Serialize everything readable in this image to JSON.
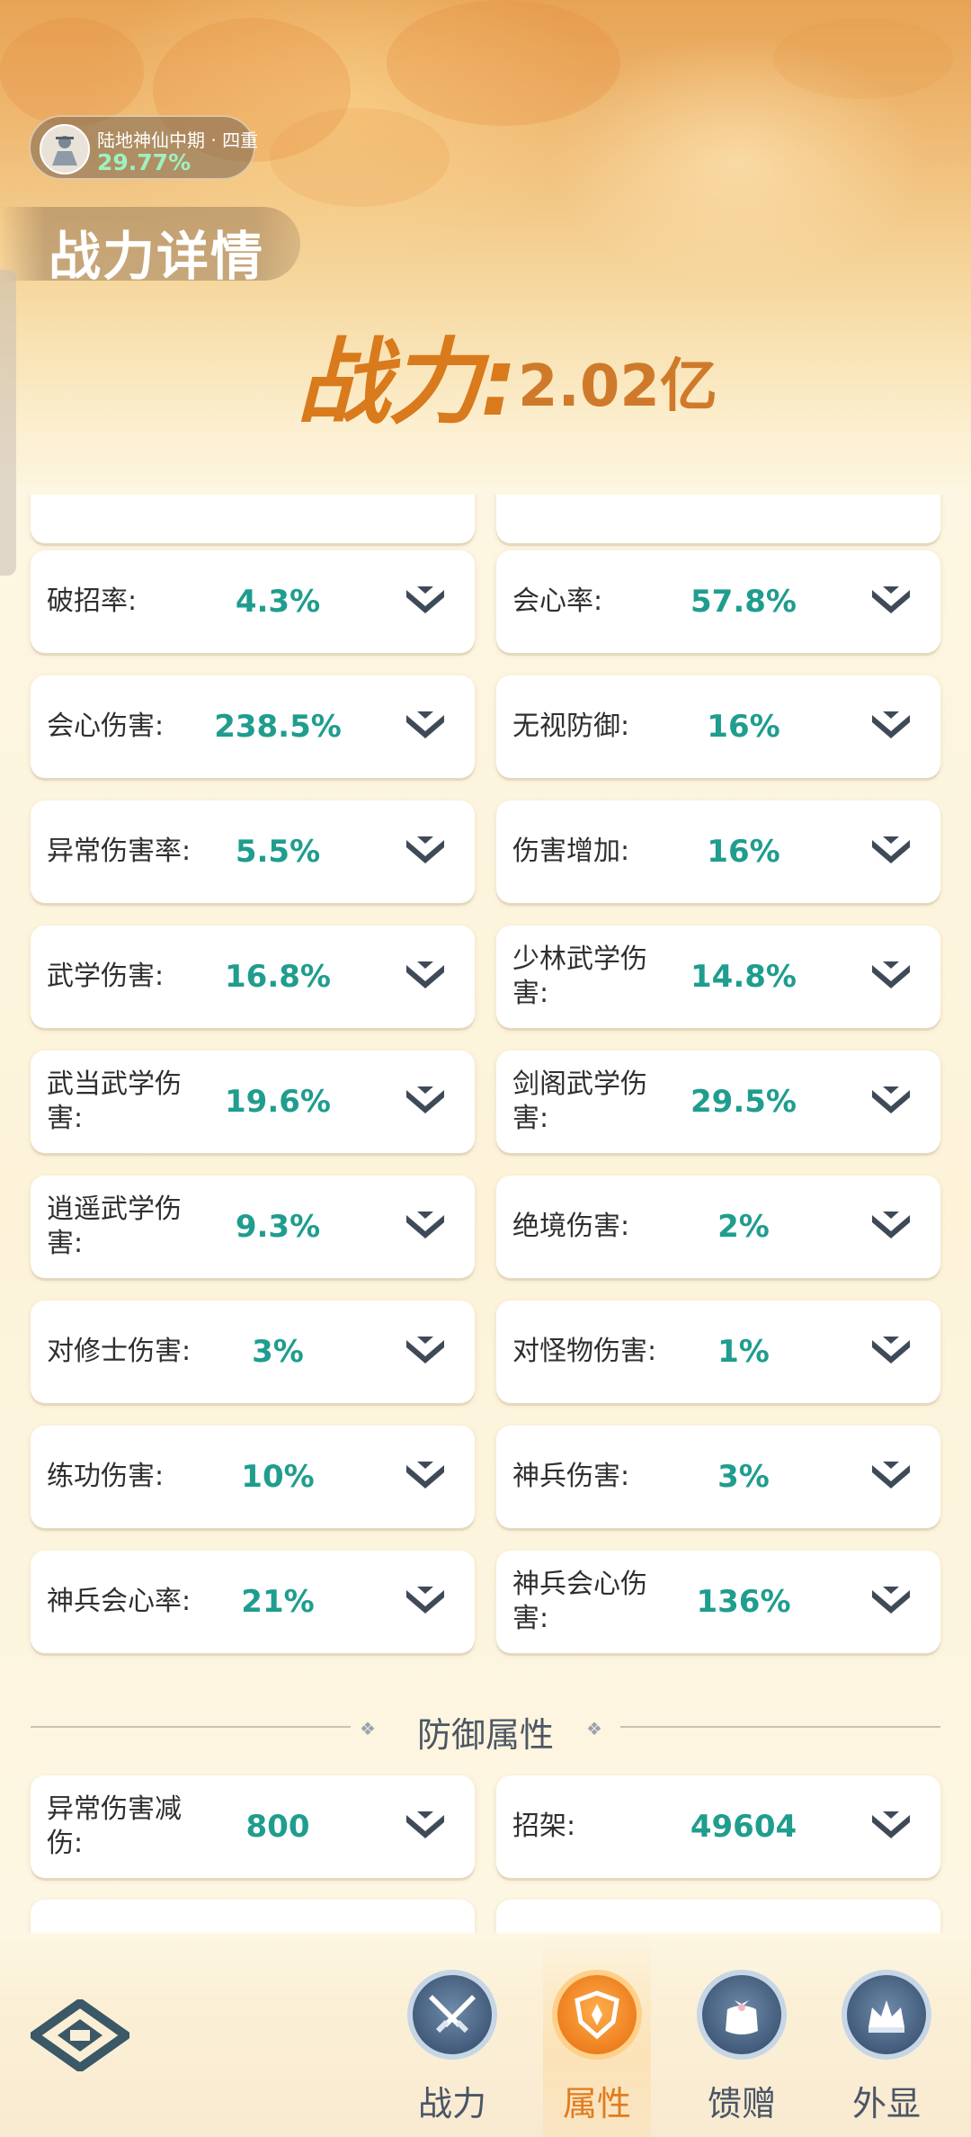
{
  "header": {
    "level_name": "陆地神仙中期 · 四重",
    "level_progress": "29.77%",
    "title": "战力详情",
    "power_label": "战力:",
    "power_value": "2.02亿"
  },
  "stats": [
    {
      "label": "破招率:",
      "value": "4.3%"
    },
    {
      "label": "会心率:",
      "value": "57.8%"
    },
    {
      "label": "会心伤害:",
      "value": "238.5%"
    },
    {
      "label": "无视防御:",
      "value": "16%"
    },
    {
      "label": "异常伤害率:",
      "value": "5.5%"
    },
    {
      "label": "伤害增加:",
      "value": "16%"
    },
    {
      "label": "武学伤害:",
      "value": "16.8%"
    },
    {
      "label": "少林武学伤害:",
      "value": "14.8%"
    },
    {
      "label": "武当武学伤害:",
      "value": "19.6%"
    },
    {
      "label": "剑阁武学伤害:",
      "value": "29.5%"
    },
    {
      "label": "逍遥武学伤害:",
      "value": "9.3%"
    },
    {
      "label": "绝境伤害:",
      "value": "2%"
    },
    {
      "label": "对修士伤害:",
      "value": "3%"
    },
    {
      "label": "对怪物伤害:",
      "value": "1%"
    },
    {
      "label": "练功伤害:",
      "value": "10%"
    },
    {
      "label": "神兵伤害:",
      "value": "3%"
    },
    {
      "label": "神兵会心率:",
      "value": "21%"
    },
    {
      "label": "神兵会心伤害:",
      "value": "136%"
    }
  ],
  "defense_section": {
    "title": "防御属性",
    "stats": [
      {
        "label": "异常伤害减伤:",
        "value": "800"
      },
      {
        "label": "招架:",
        "value": "49604"
      }
    ]
  },
  "bottom_nav": {
    "items": [
      {
        "label": "战力",
        "icon": "swords-icon"
      },
      {
        "label": "属性",
        "icon": "shield-icon",
        "active": true
      },
      {
        "label": "馈赠",
        "icon": "gift-bag-icon"
      },
      {
        "label": "外显",
        "icon": "crown-icon"
      }
    ]
  },
  "colors": {
    "accent_orange": "#d97a1c",
    "value_teal": "#1f9d8e",
    "text_dark": "#2f2f2f"
  }
}
